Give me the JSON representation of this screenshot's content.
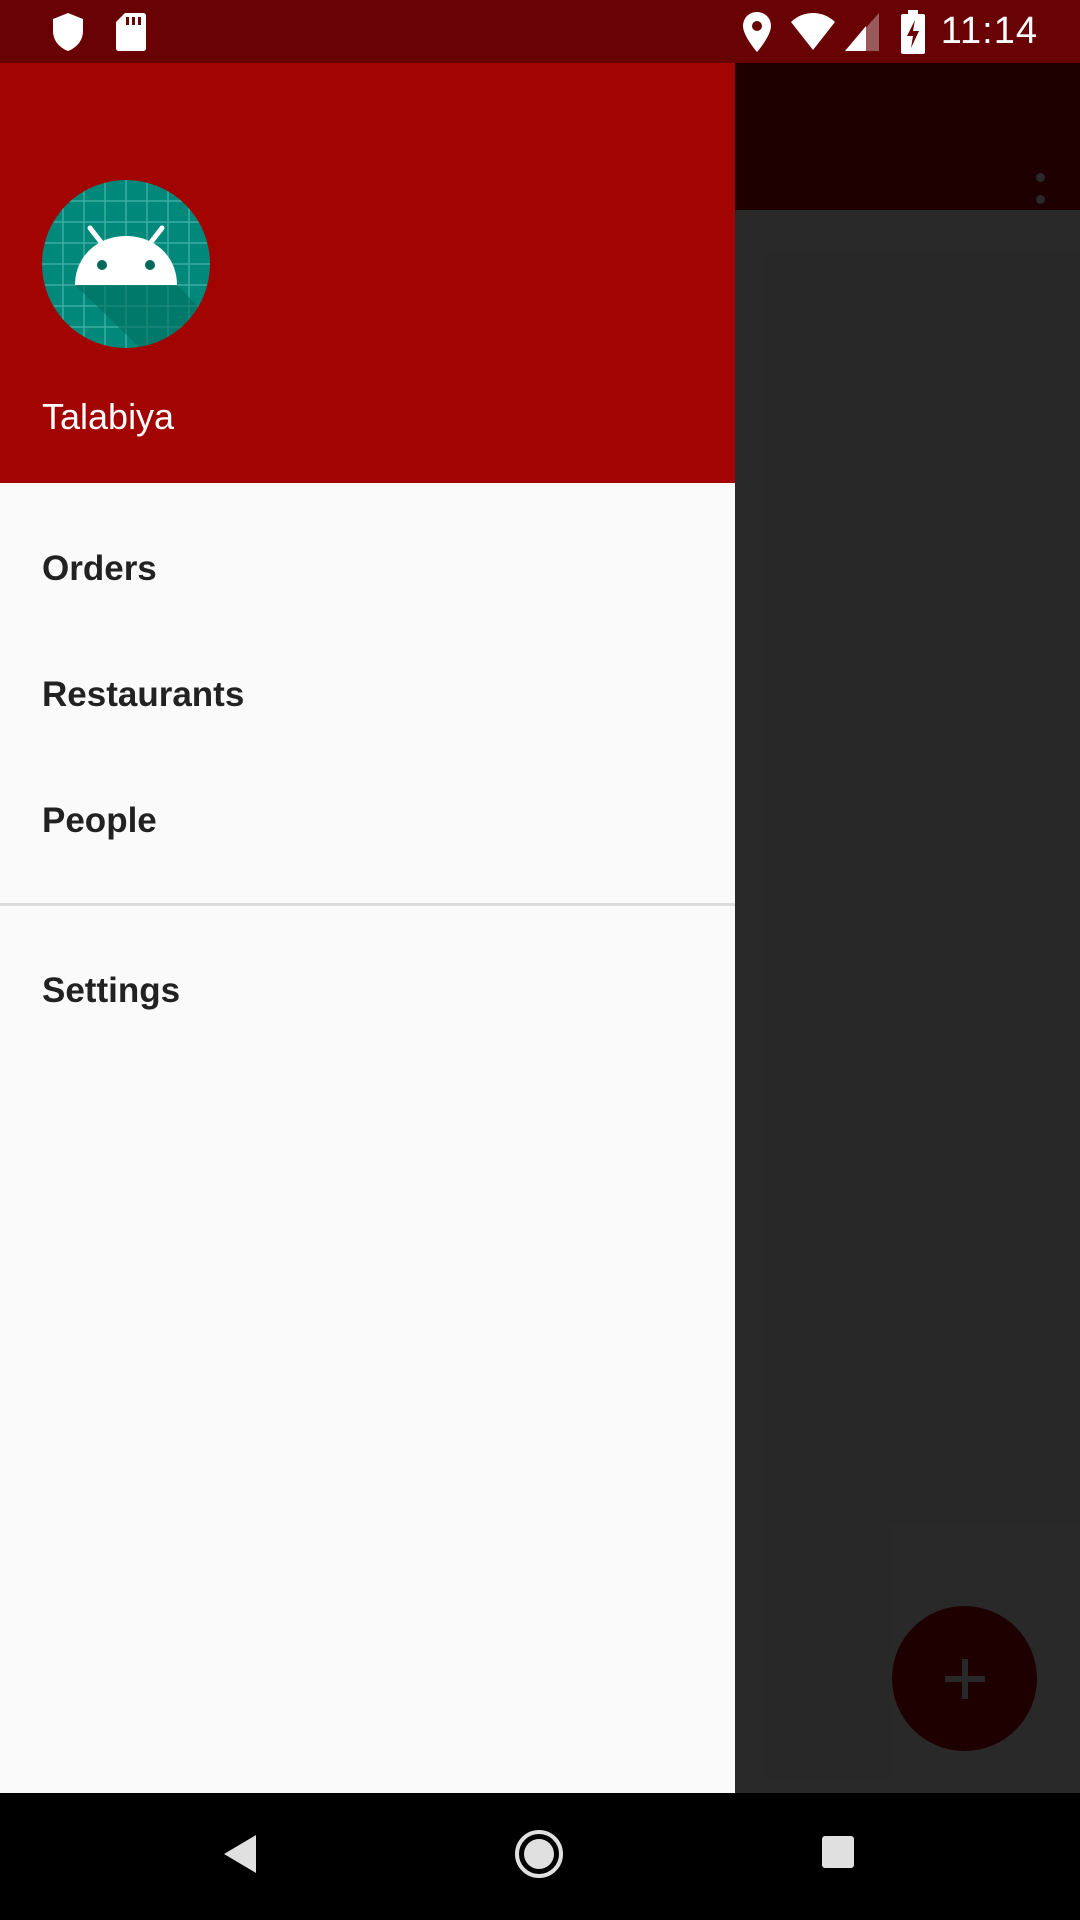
{
  "status_bar": {
    "time": "11:14",
    "icons": [
      "shield-icon",
      "sd-card-icon",
      "location-icon",
      "wifi-icon",
      "signal-icon",
      "battery-charging-icon"
    ]
  },
  "drawer": {
    "header": {
      "app_name": "Talabiya",
      "avatar_icon": "android-icon"
    },
    "menu_items": [
      {
        "label": "Orders"
      },
      {
        "label": "Restaurants"
      },
      {
        "label": "People"
      }
    ],
    "secondary_items": [
      {
        "label": "Settings"
      }
    ]
  },
  "background_app": {
    "overflow_icon": "more-vert-icon",
    "fab_icon": "plus-icon"
  },
  "nav_bar": {
    "buttons": [
      "back-icon",
      "home-icon",
      "recents-icon"
    ]
  },
  "colors": {
    "status_bar": "#680205",
    "drawer_header": "#a20402",
    "drawer_bg": "#fafafa",
    "avatar_bg": "#00897b",
    "fab": "#c00000"
  }
}
